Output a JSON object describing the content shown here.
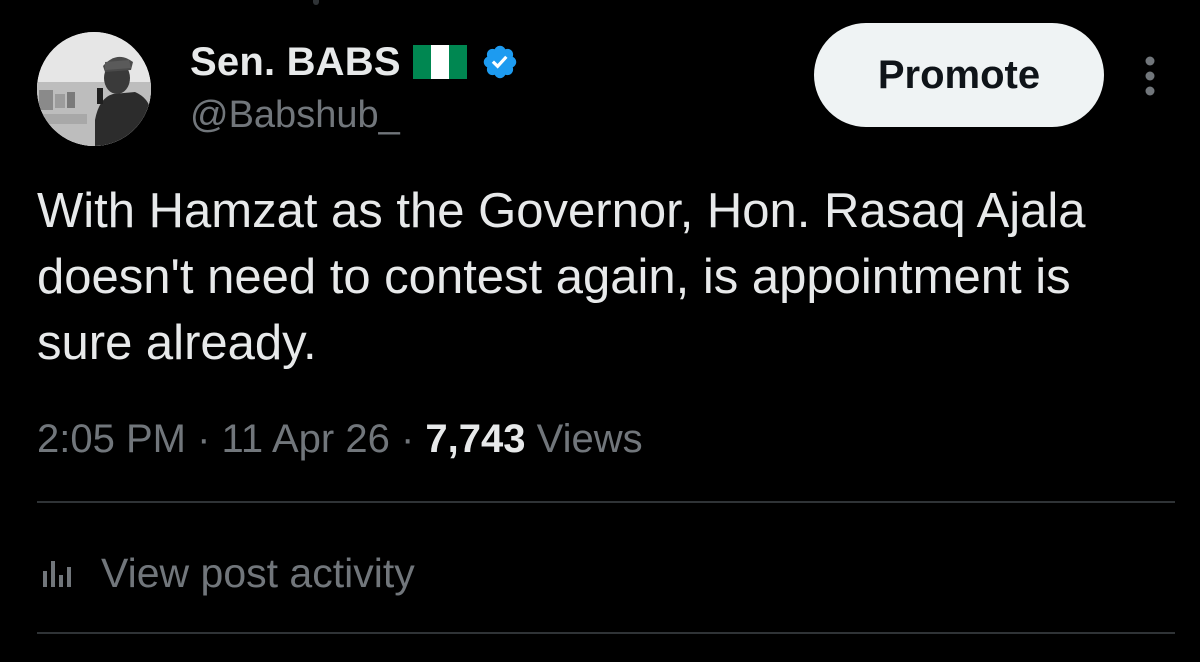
{
  "author": {
    "display_name": "Sen. BABS",
    "handle": "@Babshub_",
    "flag_icon": "nigeria-flag-icon",
    "verified_icon": "verified-badge-icon",
    "verified_color": "#1d9bf0"
  },
  "actions": {
    "promote_label": "Promote",
    "more_icon": "more-vertical-icon"
  },
  "tweet": {
    "text": "With Hamzat as the Governor, Hon. Rasaq Ajala doesn't need to contest again, is appointment is sure already."
  },
  "meta": {
    "time": "2:05 PM",
    "separator": "·",
    "date": "11 Apr 26",
    "views_count": "7,743",
    "views_label": "Views"
  },
  "activity": {
    "icon": "bar-chart-icon",
    "label": "View post activity"
  },
  "colors": {
    "background": "#000000",
    "primary_text": "#e7e9ea",
    "secondary_text": "#71767b",
    "divider": "#2f3336",
    "button_bg": "#eff3f4",
    "flag_green": "#008751"
  }
}
